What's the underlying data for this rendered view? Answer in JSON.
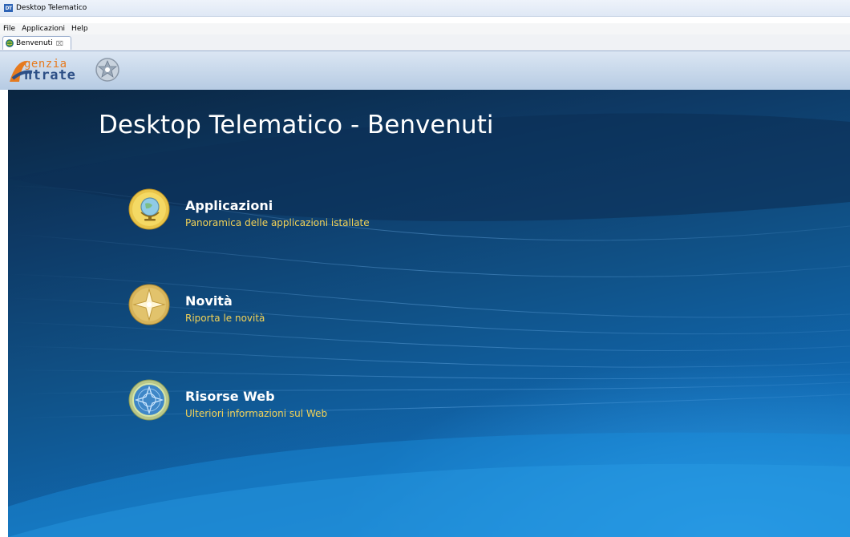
{
  "window": {
    "title": "Desktop Telematico",
    "icon_text": "DT"
  },
  "menu": [
    {
      "label": "File"
    },
    {
      "label": "Applicazioni"
    },
    {
      "label": "Help"
    }
  ],
  "tab": {
    "label": "Benvenuti",
    "close_glyph": "⌧"
  },
  "logo": {
    "line1": "genzia",
    "line2": "ntrate"
  },
  "page": {
    "title": "Desktop Telematico - Benvenuti"
  },
  "entries": [
    {
      "title": "Applicazioni",
      "description": "Panoramica delle applicazioni istallate",
      "icon": "globe-icon"
    },
    {
      "title": "Novità",
      "description": "Riporta le novità",
      "icon": "star-icon"
    },
    {
      "title": "Risorse Web",
      "description": "Ulteriori informazioni sul Web",
      "icon": "web-icon"
    }
  ],
  "colors": {
    "accent_text": "#f2d257",
    "background_dark": "#0a2540",
    "background_light": "#1a84d2"
  }
}
